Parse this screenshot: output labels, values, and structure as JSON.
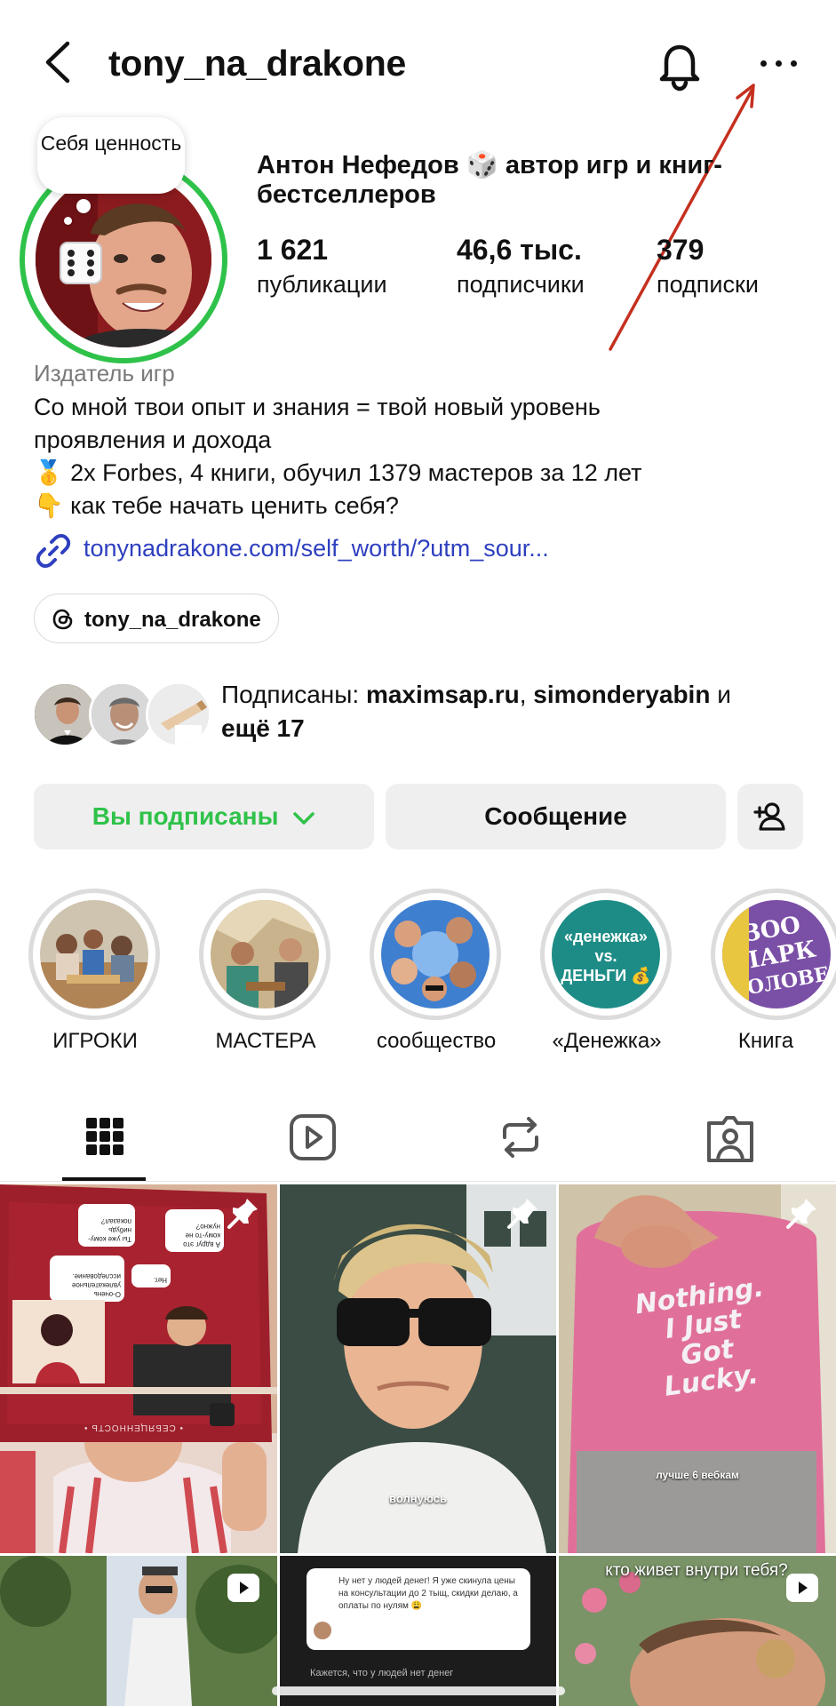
{
  "header": {
    "username": "tony_na_drakone",
    "back_icon": "chevron-left-icon",
    "bell_icon": "bell-icon",
    "more_icon": "ellipsis-icon"
  },
  "profile": {
    "note": "Себя ценность",
    "full_name": "Антон Нефедов 🎲 автор игр и книг-бестселлеров",
    "stats": [
      {
        "value": "1 621",
        "label": "публикации"
      },
      {
        "value": "46,6 тыс.",
        "label": "подписчики"
      },
      {
        "value": "379",
        "label": "подписки"
      }
    ],
    "ring_color": "#2fc24a"
  },
  "bio": {
    "category": "Издатель игр",
    "lines": [
      "Со мной твои опыт и знания = твой новый уровень",
      "проявления и дохода",
      "🥇 2x Forbes, 4 книги, обучил 1379 мастеров за 12 лет",
      "👇 как тебе начать ценить себя?"
    ],
    "link": "tonynadrakone.com/self_worth/?utm_sour...",
    "link_color": "#2e3fbf",
    "threads_handle": "tony_na_drakone"
  },
  "followed_by": {
    "prefix": "Подписаны: ",
    "name1": "maximsap.ru",
    "sep": ", ",
    "name2": "simonderyabin",
    "conj": " и",
    "more": "ещё 17"
  },
  "actions": {
    "following": "Вы подписаны",
    "following_color": "#2fc24a",
    "message": "Сообщение",
    "add_user_icon": "add-user-icon"
  },
  "highlights": [
    {
      "label": "ИГРОКИ"
    },
    {
      "label": "МАСТЕРА"
    },
    {
      "label": "сообщество"
    },
    {
      "label": "«Денежка»",
      "cover_text_1": "«денежка»",
      "cover_text_2": "vs.",
      "cover_text_3": "ДЕНЬГИ 💰"
    },
    {
      "label": "Книга",
      "cover_text_1": "ЗОО",
      "cover_text_2": "ПАРК",
      "cover_text_3": "ГОЛОВЕ"
    }
  ],
  "tabs": [
    {
      "icon": "grid-icon",
      "active": true
    },
    {
      "icon": "reels-icon",
      "active": false
    },
    {
      "icon": "repost-icon",
      "active": false
    },
    {
      "icon": "tagged-icon",
      "active": false
    }
  ],
  "posts": [
    {
      "caption": "",
      "card_bubbles": [
        "Ты уже кому-нибудь показал?",
        "А вдруг это кому-то не нужно?",
        "О-очень увлекательное исследование.",
        "Нет."
      ],
      "card_footer": "• СЕБЯЦЕННОСТЬ •"
    },
    {
      "caption": "волнуюсь"
    },
    {
      "caption": "лучше 6 вебкам",
      "shirt_text": "Nothing. I Just Got Lucky."
    },
    {
      "caption": ""
    },
    {
      "caption": "",
      "chat_text": "Ну нет у людей денег! Я уже скинула цены на консультации до 2 тыщ, скидки делаю, а оплаты по нулям 😩",
      "bottom_text": "Кажется, что у людей нет денег"
    },
    {
      "caption": "кто живет внутри тебя?"
    }
  ]
}
